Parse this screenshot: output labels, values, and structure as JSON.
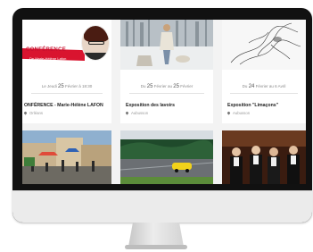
{
  "cards": [
    {
      "date_prefix": "Le Jeudi",
      "date_day": "25",
      "date_suffix": "Février à 18:30",
      "title": "ONFÉRENCE - Marie-Hélène LAFON",
      "location": "Orléans",
      "image": {
        "poster_title": "CONFÉRENCE",
        "poster_subtitle": "De Marie-Hélène Lafon"
      }
    },
    {
      "date_prefix": "Du",
      "date_day": "25",
      "date_middle": "Février au",
      "date_day2": "25",
      "date_suffix": "Février",
      "title": "Exposition des lavoirs",
      "location": "Aubusson"
    },
    {
      "date_prefix": "Du",
      "date_day": "24",
      "date_suffix": "Février au 6 Avril",
      "title": "Exposition \"Limaçons\"",
      "location": "Aubusson"
    }
  ],
  "colors": {
    "poster_red": "#d9142f",
    "bezel": "#111111",
    "chin": "#ebebeb"
  }
}
